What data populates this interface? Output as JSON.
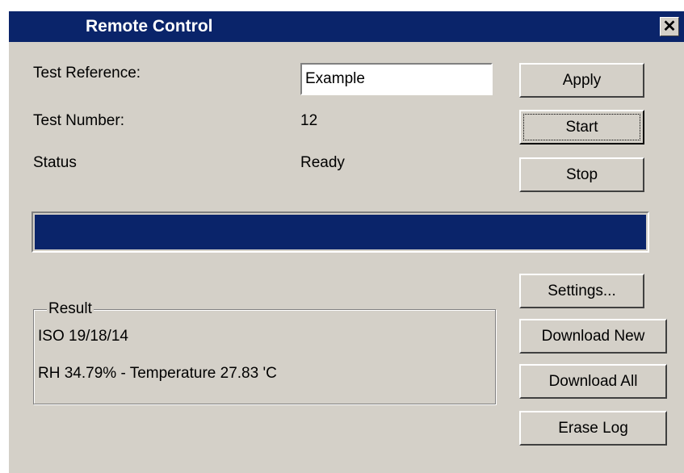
{
  "window": {
    "title": "Remote Control",
    "close_label": "✕"
  },
  "form": {
    "test_reference_label": "Test Reference:",
    "test_reference_value": "Example",
    "test_number_label": "Test Number:",
    "test_number_value": "12",
    "status_label": "Status",
    "status_value": "Ready"
  },
  "progress": {
    "fraction": 1.0
  },
  "buttons": {
    "apply": "Apply",
    "start": "Start",
    "stop": "Stop",
    "settings": "Settings...",
    "download_new": "Download New",
    "download_all": "Download All",
    "erase_log": "Erase Log"
  },
  "result": {
    "legend": "Result",
    "line1": "ISO 19/18/14",
    "line2": "RH 34.79% - Temperature 27.83 'C"
  },
  "colors": {
    "titlebar": "#0a246a",
    "progress_fill": "#0a246a",
    "window_face": "#d4d0c8"
  }
}
